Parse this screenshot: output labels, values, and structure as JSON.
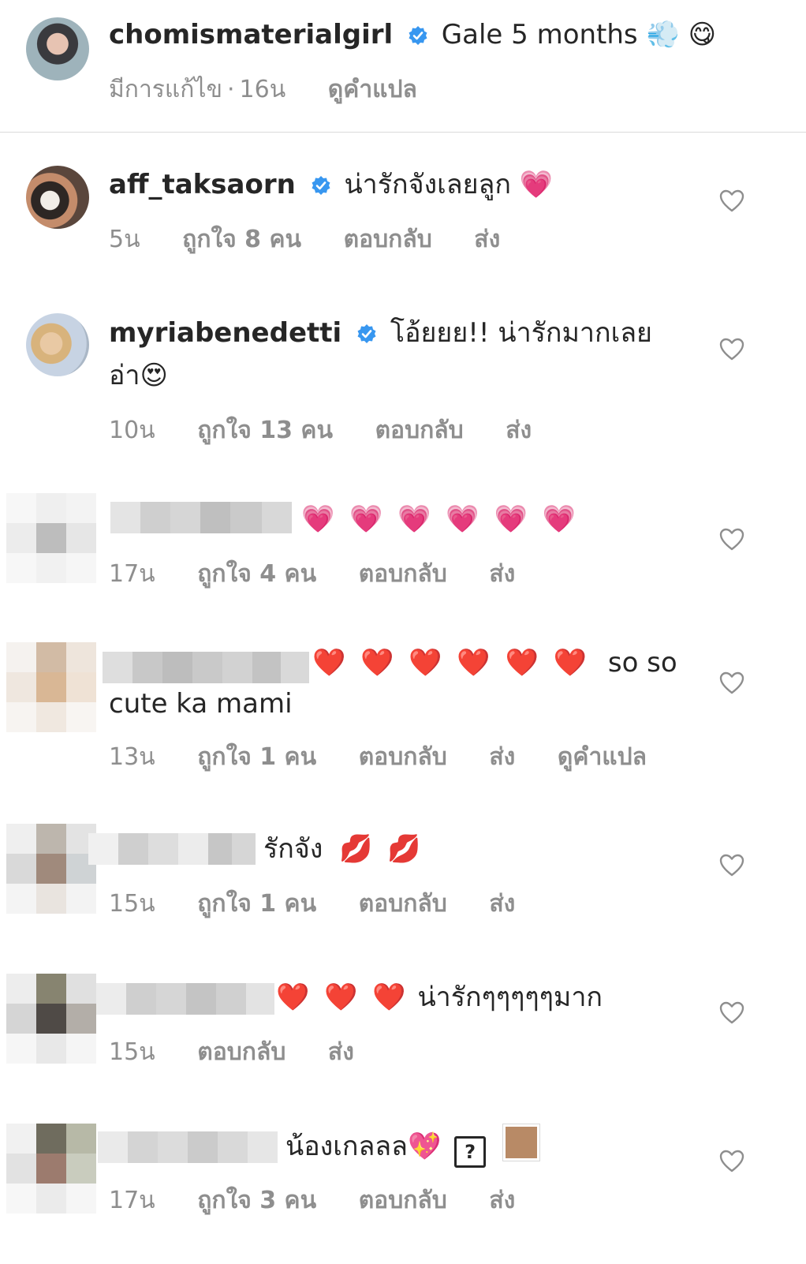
{
  "post": {
    "username": "chomismaterialgirl",
    "caption": "Gale 5 months",
    "caption_emojis": "💨 😋",
    "edited": "มีการแก้ไข",
    "time": "16น",
    "translate": "ดูคำแปล"
  },
  "comments": [
    {
      "username": "aff_taksaorn",
      "text": "น่ารักจังเลยลูก",
      "emoji": "💗",
      "time": "5น",
      "likes": "ถูกใจ 8 คน",
      "reply": "ตอบกลับ",
      "send": "ส่ง"
    },
    {
      "username": "myriabenedetti",
      "text": "โอ้ยยย!! น่ารักมากเลย",
      "text_line2": "อ่า",
      "emoji": "😍",
      "time": "10น",
      "likes": "ถูกใจ 13 คน",
      "reply": "ตอบกลับ",
      "send": "ส่ง"
    },
    {
      "username_hidden": "s",
      "emoji": "💗 💗 💗 💗 💗 💗",
      "time": "17น",
      "likes": "ถูกใจ 4 คน",
      "reply": "ตอบกลับ",
      "send": "ส่ง"
    },
    {
      "emoji": "❤️ ❤️ ❤️ ❤️ ❤️ ❤️",
      "text": "so so",
      "text_line2": "cute ka mami",
      "time": "13น",
      "likes": "ถูกใจ 1 คน",
      "reply": "ตอบกลับ",
      "send": "ส่ง",
      "translate": "ดูคำแปล"
    },
    {
      "text": "รักจัง",
      "emoji": "💋 💋",
      "time": "15น",
      "likes": "ถูกใจ 1 คน",
      "reply": "ตอบกลับ",
      "send": "ส่ง"
    },
    {
      "emoji": "❤️ ❤️ ❤️",
      "text": "น่ารักๆๆๆๆๆมาก",
      "time": "15น",
      "reply": "ตอบกลับ",
      "send": "ส่ง"
    },
    {
      "text": "น้องเกลลล",
      "emoji": "💖",
      "unknown_glyph": "?",
      "time": "17น",
      "likes": "ถูกใจ 3 คน",
      "reply": "ตอบกลับ",
      "send": "ส่ง"
    }
  ],
  "colors": {
    "text": "#262626",
    "meta": "#8e8e8e",
    "verified": "#3897f0",
    "divider": "#dbdbdb",
    "heart_outline": "#8e8e8e"
  },
  "icons": [
    "verified-badge-icon",
    "heart-outline-icon"
  ]
}
